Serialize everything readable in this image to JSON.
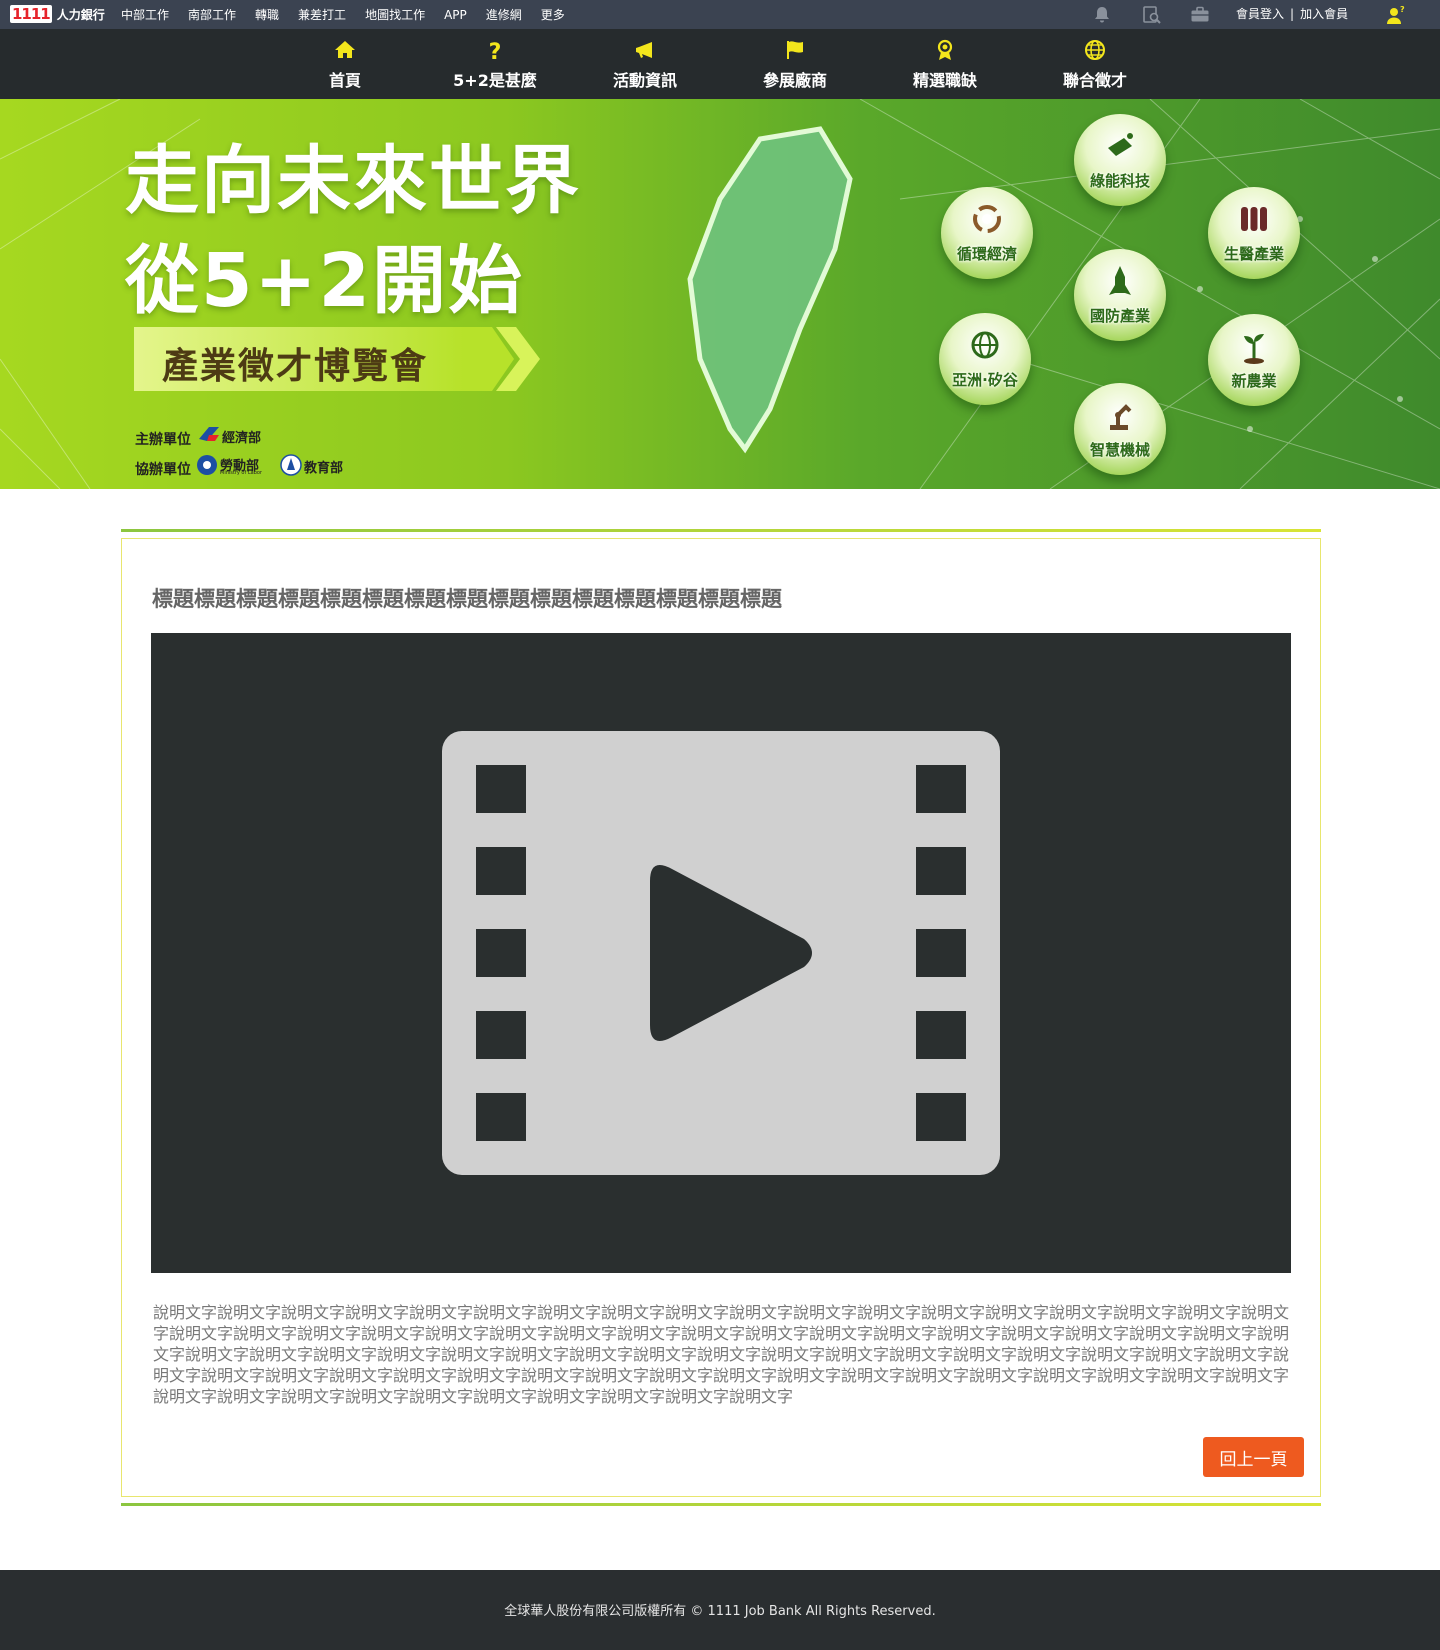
{
  "topbar": {
    "logo_number": "1111",
    "logo_text": "人力銀行",
    "links": [
      "中部工作",
      "南部工作",
      "轉職",
      "兼差打工",
      "地圖找工作",
      "APP",
      "進修網",
      "更多"
    ],
    "login": "會員登入",
    "separator": "|",
    "register": "加入會員",
    "icons": [
      "bell-icon",
      "search-document-icon",
      "briefcase-icon",
      "user-help-icon"
    ]
  },
  "nav": {
    "items": [
      {
        "label": "首頁",
        "icon": "home-icon"
      },
      {
        "label": "5+2是甚麼",
        "icon": "question-icon"
      },
      {
        "label": "活動資訊",
        "icon": "megaphone-icon"
      },
      {
        "label": "參展廠商",
        "icon": "flag-icon"
      },
      {
        "label": "精選職缺",
        "icon": "award-icon"
      },
      {
        "label": "聯合徵才",
        "icon": "globe-icon"
      }
    ],
    "icon_color": "#f3e61c"
  },
  "banner": {
    "line1": "走向未來世界",
    "line2": "從5+2開始",
    "ribbon": "產業徵才博覽會",
    "organizer_label": "主辦單位",
    "organizer": "經濟部",
    "co_organizer_label": "協辦單位",
    "co_organizers": [
      "勞動部",
      "教育部"
    ],
    "co_organizer_subtitle": "Ministry of Labor",
    "industries": [
      "綠能科技",
      "循環經濟",
      "生醫產業",
      "國防產業",
      "亞洲·矽谷",
      "新農業",
      "智慧機械"
    ]
  },
  "content": {
    "title": "標題標題標題標題標題標題標題標題標題標題標題標題標題標題標題",
    "description": "說明文字說明文字說明文字說明文字說明文字說明文字說明文字說明文字說明文字說明文字說明文字說明文字說明文字說明文字說明文字說明文字說明文字說明文字說明文字說明文字說明文字說明文字說明文字說明文字說明文字說明文字說明文字說明文字說明文字說明文字說明文字說明文字說明文字說明文字說明文字說明文字說明文字說明文字說明文字說明文字說明文字說明文字說明文字說明文字說明文字說明文字說明文字說明文字說明文字說明文字說明文字說明文字說明文字說明文字說明文字說明文字說明文字說明文字說明文字說明文字說明文字說明文字說明文字說明文字說明文字說明文字說明文字說明文字說明文字說明文字說明文字說明文字說明文字說明文字說明文字說明文字說明文字說明文字說明文字說明文字說明文字",
    "video_icon": "film-play-icon",
    "back_button": "回上一頁"
  },
  "footer": {
    "text": "全球華人股份有限公司版權所有 © 1111 Job Bank All Rights Reserved."
  },
  "colors": {
    "topbar": "#3b4351",
    "nav": "#262b2d",
    "accent_green": "#8cc63f",
    "button": "#ee5a1f",
    "footer": "#2a2e30"
  }
}
